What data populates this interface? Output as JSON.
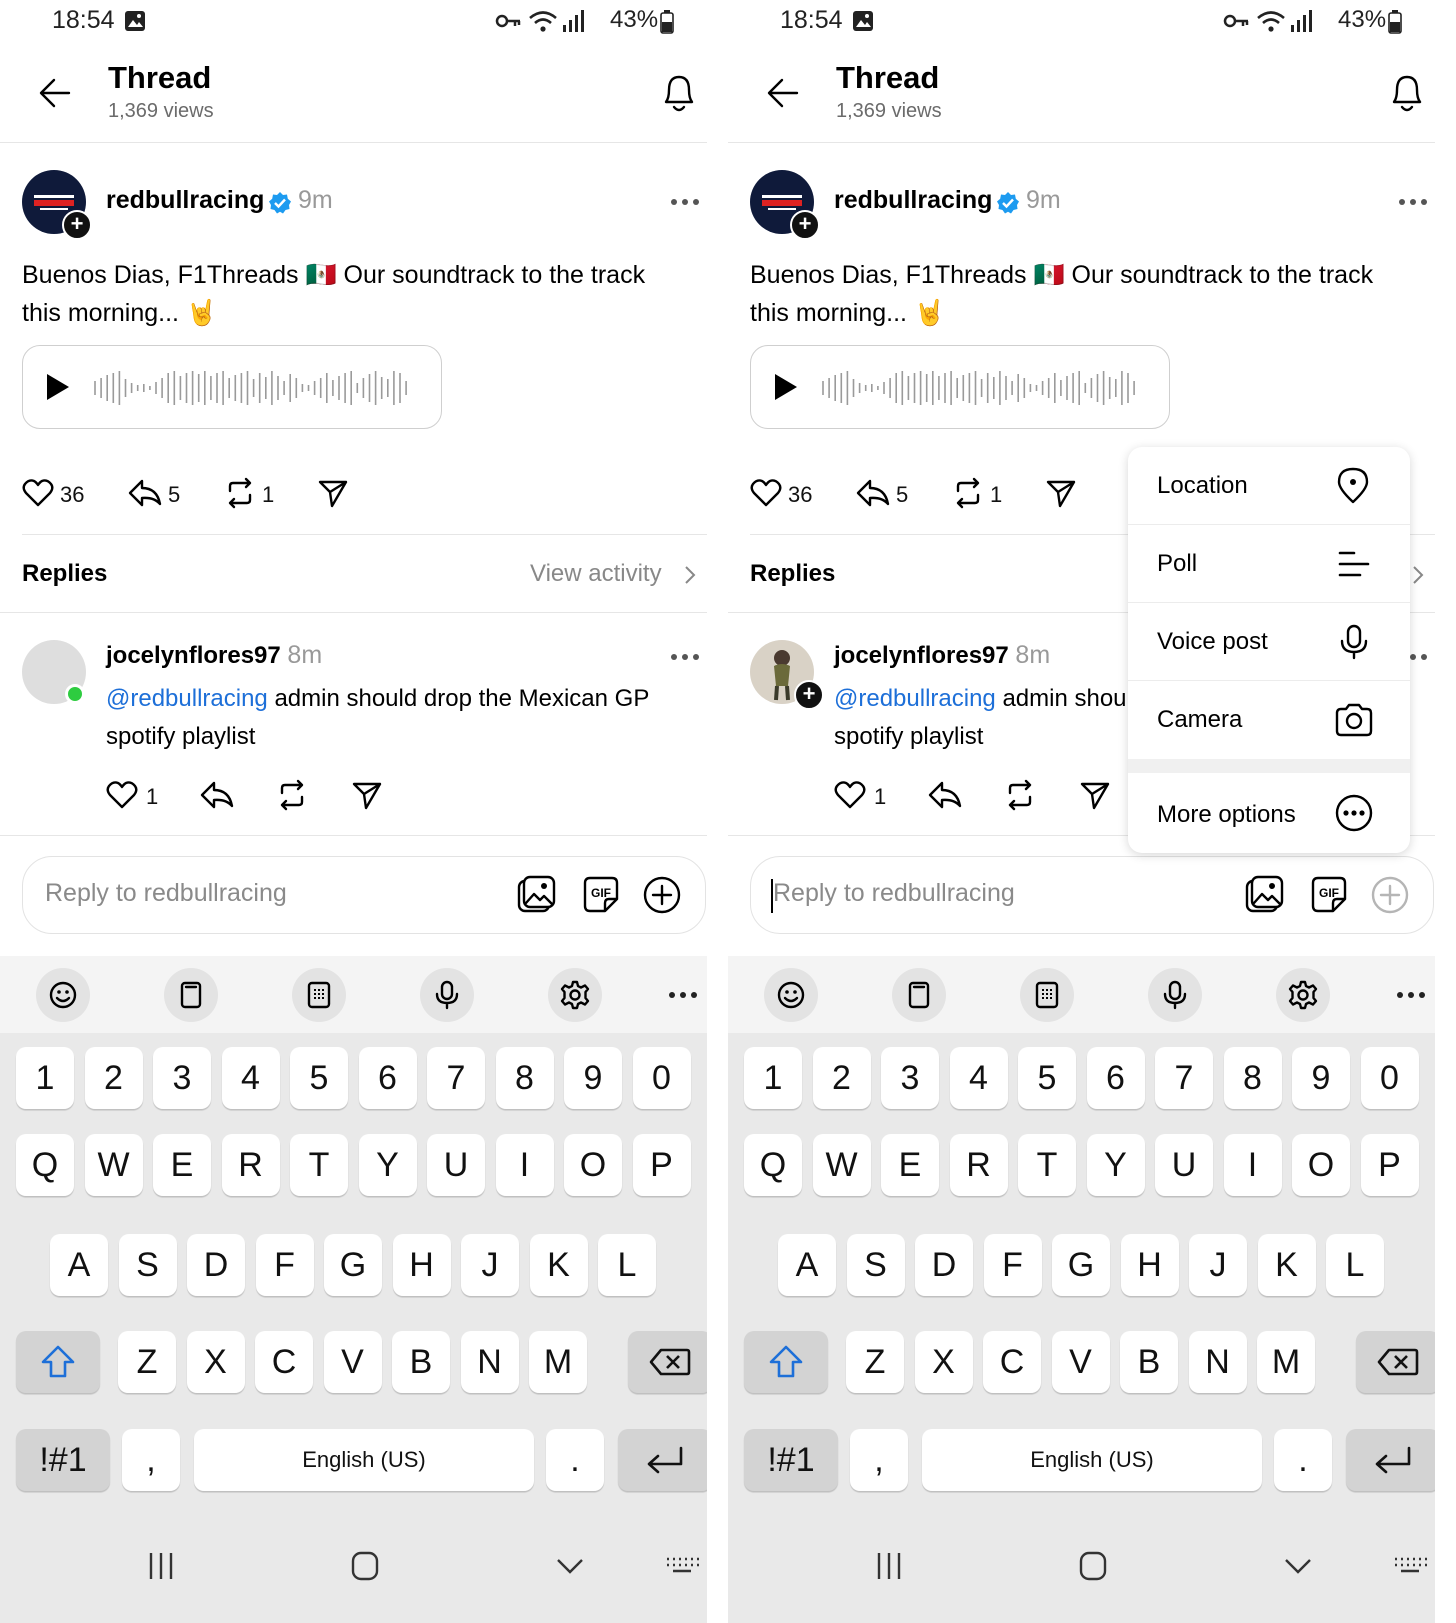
{
  "status": {
    "time": "18:54",
    "battery": "43%"
  },
  "header": {
    "title": "Thread",
    "views": "1,369 views",
    "back_icon": "arrow-left-icon",
    "bell_icon": "bell-icon"
  },
  "post": {
    "author": "redbullracing",
    "time": "9m",
    "text": "Buenos Dias, F1Threads 🇲🇽 Our soundtrack to the track this morning... 🤘",
    "likes": "36",
    "replies": "5",
    "reposts": "1"
  },
  "replies_section": {
    "label": "Replies",
    "view_activity": "View activity"
  },
  "reply": {
    "author": "jocelynflores97",
    "time": "8m",
    "mention": "@redbullracing",
    "text": " admin should drop the Mexican GP spotify playlist",
    "likes": "1"
  },
  "input": {
    "placeholder": "Reply to redbullracing"
  },
  "menu": {
    "items": [
      {
        "label": "Location",
        "icon": "location-pin-icon"
      },
      {
        "label": "Poll",
        "icon": "poll-icon"
      },
      {
        "label": "Voice post",
        "icon": "microphone-icon"
      },
      {
        "label": "Camera",
        "icon": "camera-icon"
      },
      {
        "label": "More options",
        "icon": "more-options-icon"
      }
    ]
  },
  "keyboard": {
    "numbers": [
      "1",
      "2",
      "3",
      "4",
      "5",
      "6",
      "7",
      "8",
      "9",
      "0"
    ],
    "row1": [
      "Q",
      "W",
      "E",
      "R",
      "T",
      "Y",
      "U",
      "I",
      "O",
      "P"
    ],
    "row2": [
      "A",
      "S",
      "D",
      "F",
      "G",
      "H",
      "J",
      "K",
      "L"
    ],
    "row3": [
      "Z",
      "X",
      "C",
      "V",
      "B",
      "N",
      "M"
    ],
    "symbols": "!#1",
    "comma": ",",
    "space": "English (US)",
    "period": "."
  },
  "colors": {
    "accent_blue": "#1d6fd8",
    "verified_blue": "#1d9bf0",
    "online_green": "#2ecc40"
  }
}
